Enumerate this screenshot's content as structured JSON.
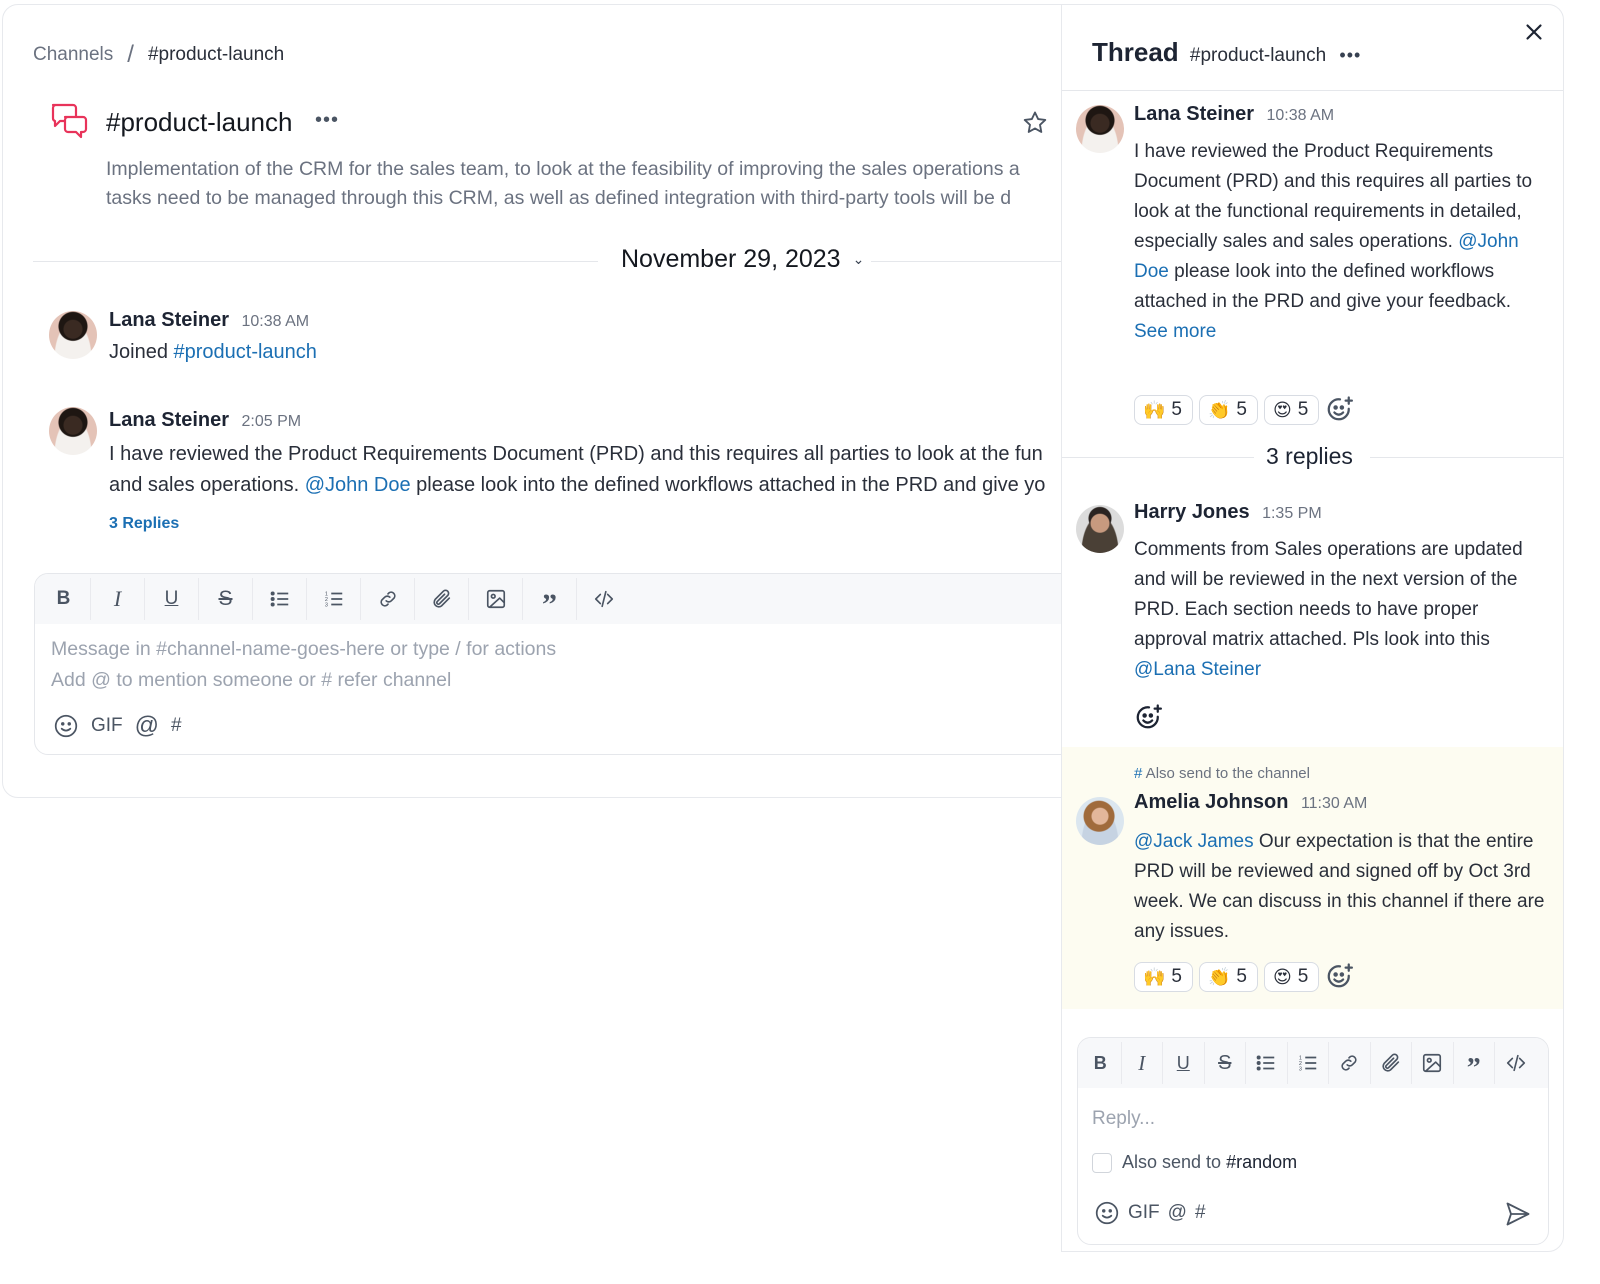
{
  "breadcrumb": {
    "root": "Channels",
    "separator": "/",
    "current": "#product-launch"
  },
  "channel": {
    "title": "#product-launch",
    "more": "•••",
    "description_line1": "Implementation of the CRM for the sales team, to look at the feasibility of improving the sales operations a",
    "description_line2": "tasks need to be managed through this CRM, as well as defined integration with third-party tools will be d",
    "icons": {
      "channel": "chat-bubbles-icon",
      "favorite": "star-icon",
      "toggle": "toggle-switch"
    },
    "accent_color": "#e8335a",
    "toggle_color": "#16a34a"
  },
  "date_divider": {
    "label": "November 29, 2023",
    "icon": "chevron-down-icon"
  },
  "messages": [
    {
      "author": "Lana Steiner",
      "time": "10:38 AM",
      "text_prefix": "Joined ",
      "channel_link": "#product-launch"
    },
    {
      "author": "Lana Steiner",
      "time": "2:05 PM",
      "line1": "I have reviewed the Product Requirements Document (PRD) and this requires all parties to look at the fun",
      "line2_prefix": "and sales operations. ",
      "mention": "@John Doe",
      "line2_suffix": " please look into the defined workflows attached in the PRD and give yo",
      "replies_link": "3 Replies"
    }
  ],
  "composer": {
    "toolbar": [
      "bold",
      "italic",
      "underline",
      "strikethrough",
      "bullet-list",
      "numbered-list",
      "link",
      "attachment",
      "image",
      "quote",
      "code"
    ],
    "placeholder_line1": "Message in #channel-name-goes-here or type / for actions",
    "placeholder_line2": "Add @ to mention someone or # refer channel",
    "actions": {
      "gif": "GIF",
      "at": "@",
      "hash": "#"
    }
  },
  "thread": {
    "title": "Thread",
    "channel": "#product-launch",
    "more": "•••",
    "parent": {
      "author": "Lana Steiner",
      "time": "10:38 AM",
      "text_before": "I have reviewed the Product Requirements Document (PRD) and this requires all parties to look at the functional requirements in detailed, especially sales and sales operations. ",
      "mention": "@John Doe",
      "text_after": " please look into the defined workflows attached in the PRD and give your feedback.",
      "see_more": "See more",
      "reactions": [
        {
          "emoji": "🙌",
          "count": "5"
        },
        {
          "emoji": "👏",
          "count": "5"
        },
        {
          "emoji": "😍",
          "count": "5"
        }
      ]
    },
    "replies_label": "3 replies",
    "replies": [
      {
        "author": "Harry Jones",
        "time": "1:35 PM",
        "text_before": "Comments from Sales operations are updated and will be reviewed in the next version of the PRD. Each section needs to have proper approval matrix attached. Pls look into this ",
        "mention": "@Lana Steiner",
        "text_after": ""
      },
      {
        "also_sent_hash": "#",
        "also_sent_label": " Also send to the channel",
        "author": "Amelia Johnson",
        "time": "11:30 AM",
        "mention": "@Jack James",
        "text_after": " Our expectation is that the entire PRD will be reviewed and signed off by Oct 3rd week. We can discuss in this channel if there are any issues.",
        "reactions": [
          {
            "emoji": "🙌",
            "count": "5"
          },
          {
            "emoji": "👏",
            "count": "5"
          },
          {
            "emoji": "😍",
            "count": "5"
          }
        ],
        "highlight_color": "#fdfcf1"
      }
    ],
    "reply_box": {
      "placeholder": "Reply...",
      "also_send_prefix": "Also send to ",
      "also_send_channel": "#random",
      "also_send_checked": false,
      "actions": {
        "gif": "GIF",
        "at": "@",
        "hash": "#"
      }
    }
  },
  "link_color": "#1b6fb3"
}
